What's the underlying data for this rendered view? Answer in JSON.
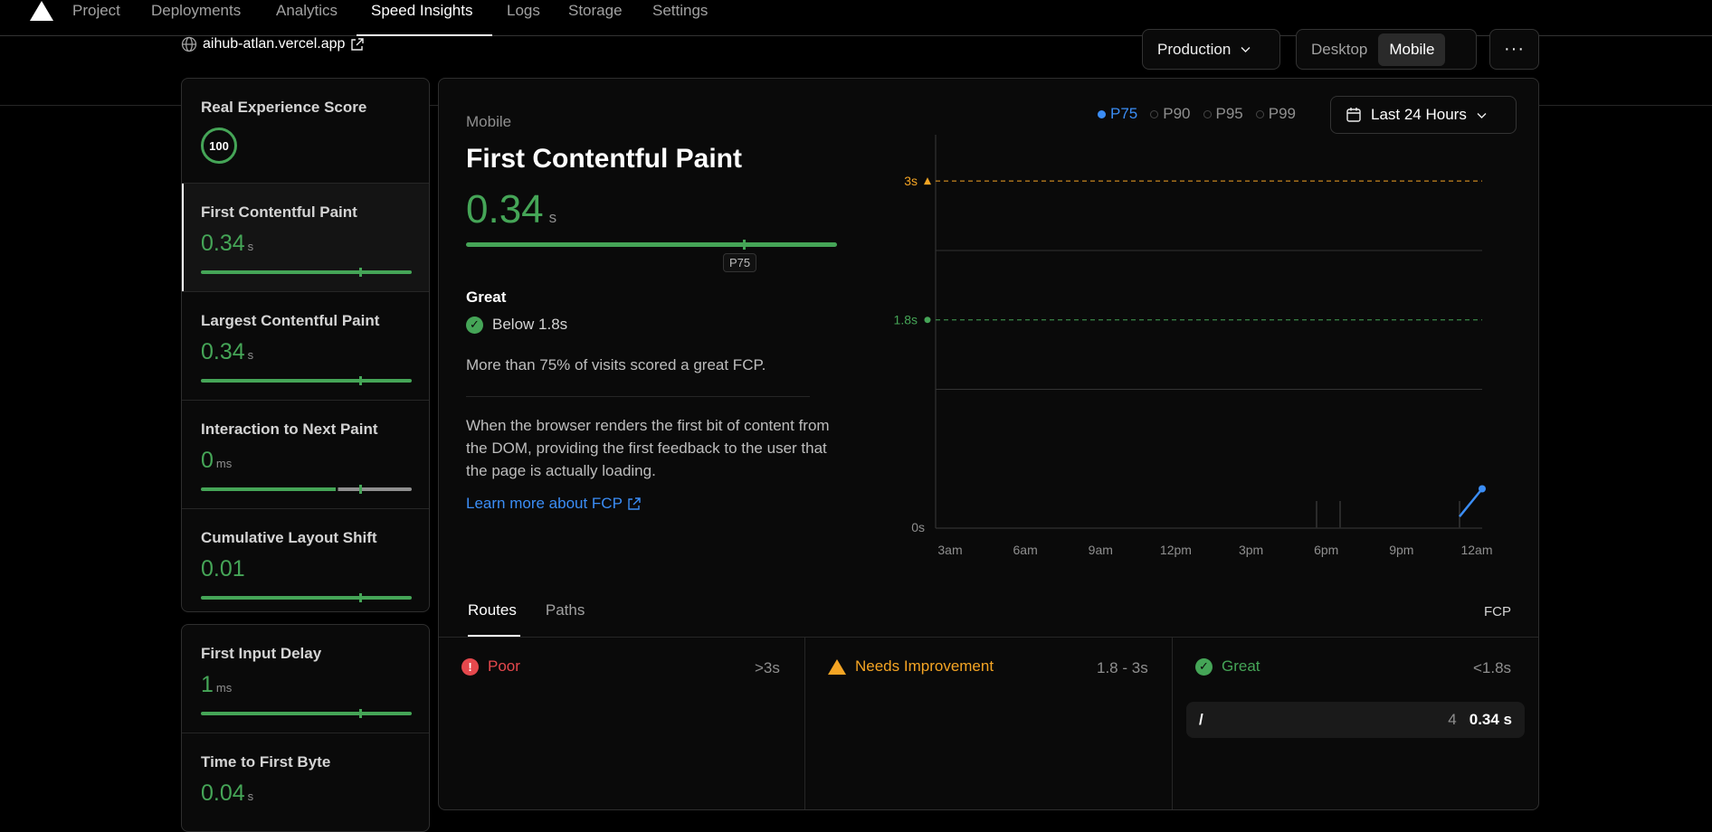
{
  "nav": {
    "items": [
      "Project",
      "Deployments",
      "Analytics",
      "Speed Insights",
      "Logs",
      "Storage",
      "Settings"
    ],
    "active": "Speed Insights"
  },
  "project": {
    "domain": "aihub-atlan.vercel.app"
  },
  "controls": {
    "environment": "Production",
    "device_options": [
      "Desktop",
      "Mobile"
    ],
    "device_selected": "Mobile",
    "more": "···"
  },
  "sidebar": {
    "score": {
      "label": "Real Experience Score",
      "value": "100"
    },
    "metrics": [
      {
        "name": "First Contentful Paint",
        "value": "0.34",
        "unit": "s",
        "active": true
      },
      {
        "name": "Largest Contentful Paint",
        "value": "0.34",
        "unit": "s"
      },
      {
        "name": "Interaction to Next Paint",
        "value": "0",
        "unit": "ms"
      },
      {
        "name": "Cumulative Layout Shift",
        "value": "0.01",
        "unit": ""
      }
    ],
    "metrics2": [
      {
        "name": "First Input Delay",
        "value": "1",
        "unit": "ms"
      },
      {
        "name": "Time to First Byte",
        "value": "0.04",
        "unit": "s"
      }
    ]
  },
  "detail": {
    "device": "Mobile",
    "title": "First Contentful Paint",
    "value": "0.34",
    "unit": "s",
    "percentile_tip": "P75",
    "rating_heading": "Great",
    "rating_text": "Below 1.8s",
    "summary": "More than 75% of visits scored a great FCP.",
    "description": "When the browser renders the first bit of content from the DOM, providing the first feedback to the user that the page is actually loading.",
    "learn_more": "Learn more about FCP"
  },
  "percentiles": {
    "options": [
      "P75",
      "P90",
      "P95",
      "P99"
    ],
    "selected": "P75"
  },
  "time_range": "Last 24 Hours",
  "colors": {
    "great": "#45a557",
    "warn": "#f5a524",
    "poor": "#e5484d",
    "accent": "#3b8df5"
  },
  "chart_data": {
    "type": "line",
    "x_ticks": [
      "3am",
      "6am",
      "9am",
      "12pm",
      "3pm",
      "6pm",
      "9pm",
      "12am"
    ],
    "y_ticks": [
      "0s",
      "1.8s",
      "3s"
    ],
    "thresholds": [
      {
        "label": "3s",
        "value": 3,
        "color": "#f5a524"
      },
      {
        "label": "1.8s",
        "value": 1.8,
        "color": "#45a557"
      }
    ],
    "ylim": [
      0,
      3.4
    ],
    "series": [
      {
        "values": [
          {
            "x": "12:30am",
            "y": 0.1
          },
          {
            "x": "1:30am",
            "y": 0.34
          }
        ]
      }
    ]
  },
  "breakdown": {
    "tabs": [
      "Routes",
      "Paths"
    ],
    "selected_tab": "Routes",
    "metric": "FCP",
    "columns": [
      {
        "label": "Poor",
        "range": ">3s"
      },
      {
        "label": "Needs Improvement",
        "range": "1.8 - 3s"
      },
      {
        "label": "Great",
        "range": "<1.8s"
      }
    ],
    "great_rows": [
      {
        "route": "/",
        "count": "4",
        "value": "0.34 s"
      }
    ]
  }
}
